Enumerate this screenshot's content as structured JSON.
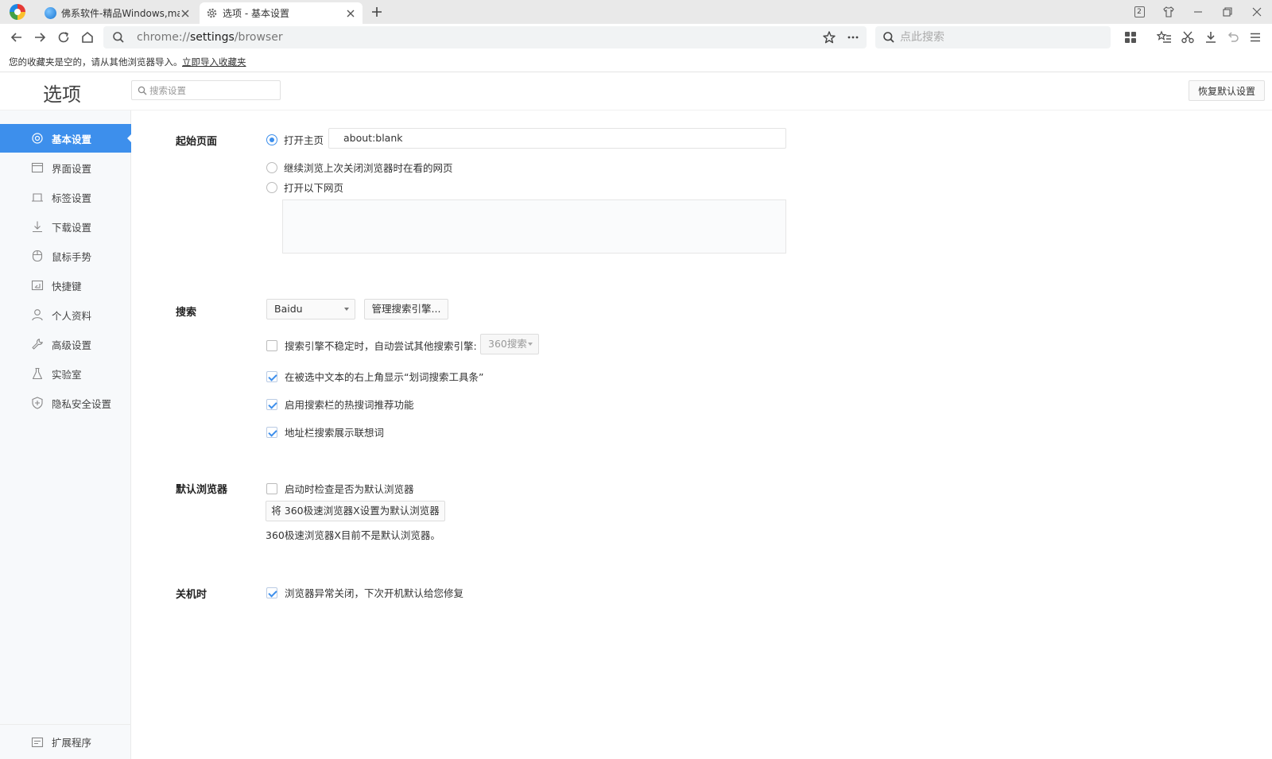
{
  "tabs": [
    {
      "title": "佛系软件-精品Windows,mac"
    },
    {
      "title": "选项 - 基本设置"
    }
  ],
  "window": {
    "tab_count_badge": "2"
  },
  "address_bar": {
    "url_prefix": "chrome://",
    "url_host": "settings",
    "url_path": "/browser"
  },
  "search_bar": {
    "placeholder": "点此搜索"
  },
  "bookmark_bar": {
    "empty_message": "您的收藏夹是空的，请从其他浏览器导入。",
    "import_link": "立即导入收藏夹"
  },
  "settings": {
    "title": "选项",
    "search_placeholder": "搜索设置",
    "reset_label": "恢复默认设置"
  },
  "sidebar": {
    "items": [
      {
        "label": "基本设置",
        "icon": "gear-icon",
        "active": true
      },
      {
        "label": "界面设置",
        "icon": "window-icon"
      },
      {
        "label": "标签设置",
        "icon": "tab-icon"
      },
      {
        "label": "下载设置",
        "icon": "download-icon"
      },
      {
        "label": "鼠标手势",
        "icon": "mouse-icon"
      },
      {
        "label": "快捷键",
        "icon": "shortcut-icon"
      },
      {
        "label": "个人资料",
        "icon": "user-icon"
      },
      {
        "label": "高级设置",
        "icon": "wrench-icon"
      },
      {
        "label": "实验室",
        "icon": "flask-icon"
      },
      {
        "label": "隐私安全设置",
        "icon": "shield-icon"
      }
    ],
    "extensions": {
      "label": "扩展程序",
      "icon": "extension-icon"
    }
  },
  "startup": {
    "label": "起始页面",
    "open_home": "打开主页",
    "home_url": "about:blank",
    "continue_last": "继续浏览上次关闭浏览器时在看的网页",
    "open_pages": "打开以下网页",
    "selected": "open_home"
  },
  "search": {
    "label": "搜索",
    "engine": "Baidu",
    "manage_button": "管理搜索引擎...",
    "fallback_label": "搜索引擎不稳定时，自动尝试其他搜索引擎:",
    "fallback_checked": false,
    "fallback_engine": "360搜索",
    "show_toolbar_label": "在被选中文本的右上角显示“划词搜索工具条”",
    "show_toolbar_checked": true,
    "hot_words_label": "启用搜索栏的热搜词推荐功能",
    "hot_words_checked": true,
    "suggest_label": "地址栏搜索展示联想词",
    "suggest_checked": true
  },
  "default_browser": {
    "label": "默认浏览器",
    "check_on_start": "启动时检查是否为默认浏览器",
    "check_on_start_checked": false,
    "set_default_button": "将 360极速浏览器X设置为默认浏览器",
    "status": "360极速浏览器X目前不是默认浏览器。"
  },
  "shutdown": {
    "label": "关机时",
    "restore_label": "浏览器异常关闭，下次开机默认给您修复",
    "restore_checked": true
  },
  "colors": {
    "accent": "#3d8fec",
    "tabstrip": "#e9e9e9",
    "sidebar_bg": "#f7f9fb"
  }
}
